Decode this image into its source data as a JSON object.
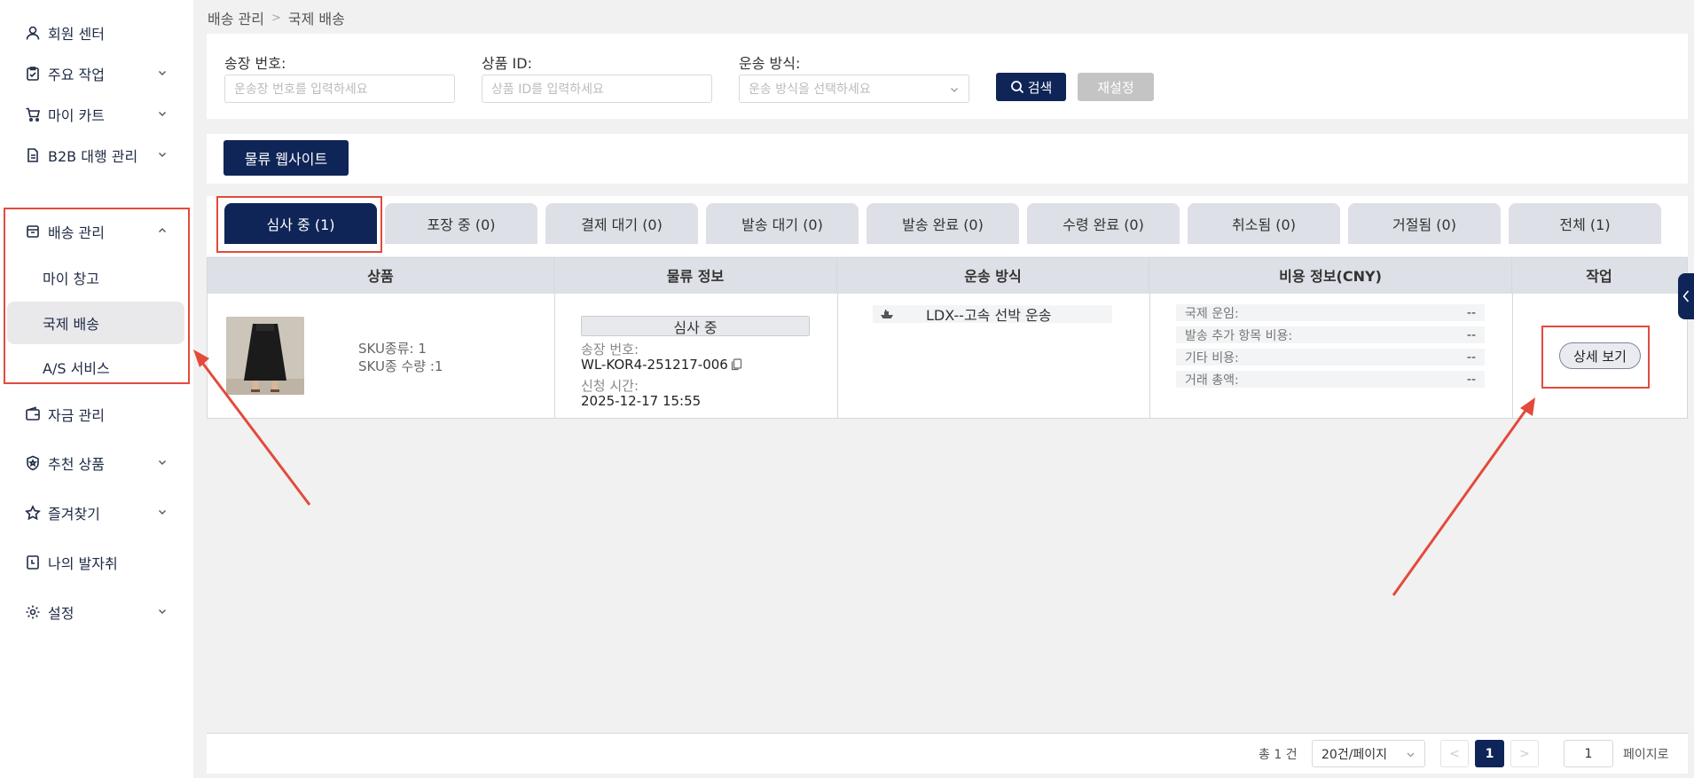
{
  "sidebar": {
    "items": [
      {
        "label": "회원 센터",
        "icon": "user-icon"
      },
      {
        "label": "주요 작업",
        "icon": "clipboard-check-icon"
      },
      {
        "label": "마이 카트",
        "icon": "cart-icon"
      },
      {
        "label": "B2B 대행 관리",
        "icon": "document-icon"
      },
      {
        "label": "배송 관리",
        "icon": "box-icon"
      },
      {
        "label": "자금 관리",
        "icon": "wallet-icon"
      },
      {
        "label": "추천 상품",
        "icon": "badge-icon"
      },
      {
        "label": "즐겨찾기",
        "icon": "star-icon"
      },
      {
        "label": "나의 발자취",
        "icon": "footprint-doc-icon"
      },
      {
        "label": "설정",
        "icon": "gear-icon"
      }
    ],
    "sub_items": [
      {
        "label": "마이 창고"
      },
      {
        "label": "국제 배송"
      },
      {
        "label": "A/S 서비스"
      }
    ]
  },
  "breadcrumb": {
    "parent": "배송 관리",
    "current": "국제 배송"
  },
  "search": {
    "invoice_label": "송장 번호:",
    "invoice_placeholder": "운송장 번호를 입력하세요",
    "product_label": "상품 ID:",
    "product_placeholder": "상품 ID를 입력하세요",
    "shipping_label": "운송 방식:",
    "shipping_placeholder": "운송 방식을 선택하세요",
    "search_button": "검색",
    "reset_button": "재설정"
  },
  "logistics_button": "물류 웹사이트",
  "tabs": [
    {
      "label": "심사 중 (1)"
    },
    {
      "label": "포장 중 (0)"
    },
    {
      "label": "결제 대기 (0)"
    },
    {
      "label": "발송 대기 (0)"
    },
    {
      "label": "발송 완료 (0)"
    },
    {
      "label": "수령 완료 (0)"
    },
    {
      "label": "취소됨 (0)"
    },
    {
      "label": "거절됨 (0)"
    },
    {
      "label": "전체 (1)"
    }
  ],
  "table": {
    "headers": [
      "상품",
      "물류 정보",
      "운송 방식",
      "비용 정보(CNY)",
      "작업"
    ],
    "row": {
      "sku_kinds": "SKU종류: 1",
      "sku_qty": "SKU종 수량 :1",
      "status": "심사 중",
      "invoice_label": "송장 번호:",
      "invoice_value": "WL-KOR4-251217-006",
      "applied_label": "신청 시간:",
      "applied_value": "2025-12-17 15:55",
      "shipping_method": "LDX--고속 선박 운송",
      "fees": [
        {
          "label": "국제 운임:",
          "value": "--"
        },
        {
          "label": "발송 추가 항목 비용:",
          "value": "--"
        },
        {
          "label": "기타 비용:",
          "value": "--"
        },
        {
          "label": "거래 총액:",
          "value": "--"
        }
      ],
      "action": "상세 보기"
    }
  },
  "pagination": {
    "total": "총 1 건",
    "page_size": "20건/페이지",
    "current_page": "1",
    "goto_value": "1",
    "goto_suffix": "페이지로"
  },
  "colors": {
    "accent": "#0f2557",
    "highlight": "#e34a3c"
  }
}
